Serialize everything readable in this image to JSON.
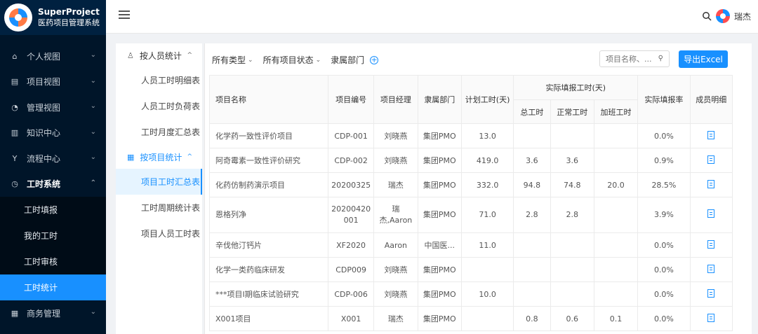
{
  "brand": {
    "name": "SuperProject",
    "subtitle": "医药项目管理系统"
  },
  "sidebar": {
    "items": [
      {
        "label": "个人视图",
        "icon": "home-icon"
      },
      {
        "label": "项目视图",
        "icon": "project-icon"
      },
      {
        "label": "管理视图",
        "icon": "dashboard-icon"
      },
      {
        "label": "知识中心",
        "icon": "book-icon"
      },
      {
        "label": "流程中心",
        "icon": "flow-icon"
      },
      {
        "label": "工时系统",
        "icon": "clock-icon"
      }
    ],
    "submenu": [
      "工时填报",
      "我的工时",
      "工时审核",
      "工时统计"
    ],
    "after": [
      {
        "label": "商务管理",
        "icon": "business-icon"
      }
    ]
  },
  "header": {
    "user": "瑞杰"
  },
  "subnav": {
    "group1": "按人员统计",
    "group1_items": [
      "人员工时明细表",
      "人员工时负荷表",
      "工时月度汇总表"
    ],
    "group2": "按项目统计",
    "group2_items": [
      "项目工时汇总表",
      "工时周期统计表",
      "项目人员工时表"
    ]
  },
  "filters": {
    "type": "所有类型",
    "status": "所有项目状态",
    "dept": "隶属部门"
  },
  "search": {
    "placeholder": "项目名称、..."
  },
  "export_label": "导出Excel",
  "table": {
    "headers": {
      "name": "项目名称",
      "code": "项目编号",
      "manager": "项目经理",
      "dept": "隶属部门",
      "planned": "计划工时(天)",
      "actual": "实际填报工时(天)",
      "total": "总工时",
      "normal": "正常工时",
      "overtime": "加班工时",
      "rate": "实际填报率",
      "detail": "成员明细"
    },
    "rows": [
      {
        "name": "化学药一致性评价项目",
        "code": "CDP-001",
        "manager": "刘晓燕",
        "dept": "集团PMO",
        "planned": "13.0",
        "total": "",
        "normal": "",
        "overtime": "",
        "rate": "0.0%"
      },
      {
        "name": "阿奇霉素一致性评价研究",
        "code": "CDP-002",
        "manager": "刘晓燕",
        "dept": "集团PMO",
        "planned": "419.0",
        "total": "3.6",
        "normal": "3.6",
        "overtime": "",
        "rate": "0.9%"
      },
      {
        "name": "化药仿制药演示项目",
        "code": "20200325",
        "manager": "瑞杰",
        "dept": "集团PMO",
        "planned": "332.0",
        "total": "94.8",
        "normal": "74.8",
        "overtime": "20.0",
        "rate": "28.5%"
      },
      {
        "name": "恩格列净",
        "code": "20200420 001",
        "manager": "瑞 杰,Aaron",
        "dept": "集团PMO",
        "planned": "71.0",
        "total": "2.8",
        "normal": "2.8",
        "overtime": "",
        "rate": "3.9%"
      },
      {
        "name": "辛伐他汀钙片",
        "code": "XF2020",
        "manager": "Aaron",
        "dept": "中国医...",
        "planned": "11.0",
        "total": "",
        "normal": "",
        "overtime": "",
        "rate": "0.0%"
      },
      {
        "name": "化学一类药临床研发",
        "code": "CDP009",
        "manager": "刘晓燕",
        "dept": "集团PMO",
        "planned": "",
        "total": "",
        "normal": "",
        "overtime": "",
        "rate": "0.0%"
      },
      {
        "name": "***项目Ⅰ期临床试验研究",
        "code": "CDP-006",
        "manager": "刘晓燕",
        "dept": "集团PMO",
        "planned": "10.0",
        "total": "",
        "normal": "",
        "overtime": "",
        "rate": "0.0%"
      },
      {
        "name": "X001项目",
        "code": "X001",
        "manager": "瑞杰",
        "dept": "集团PMO",
        "planned": "",
        "total": "0.8",
        "normal": "0.6",
        "overtime": "0.1",
        "rate": "0.0%"
      }
    ]
  }
}
